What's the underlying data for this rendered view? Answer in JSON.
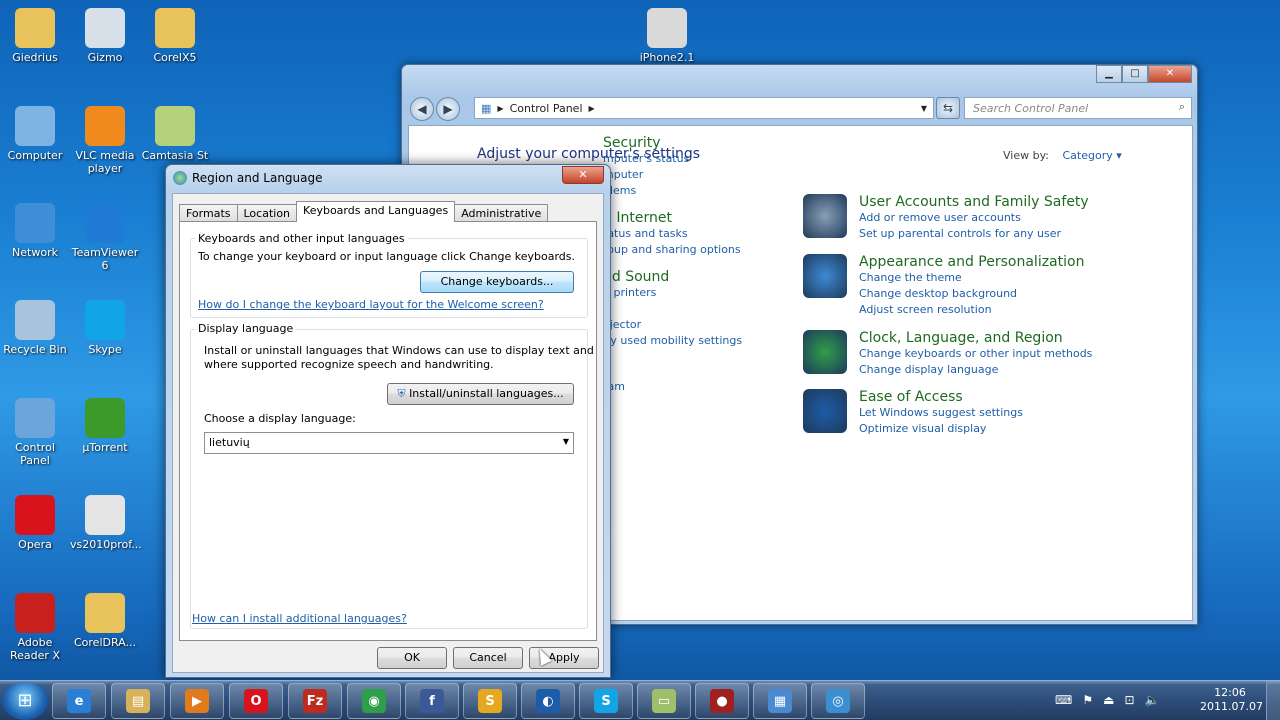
{
  "desktop": {
    "icons": [
      {
        "label": "Giedrius",
        "icon": "user-folder-icon",
        "color": "#e8c25a"
      },
      {
        "label": "Gizmo",
        "icon": "gizmo-icon",
        "color": "#d8e0ea"
      },
      {
        "label": "CorelX5",
        "icon": "folder-icon",
        "color": "#e8c25a"
      },
      {
        "label": "Computer",
        "icon": "computer-icon",
        "color": "#7eb3e6"
      },
      {
        "label": "VLC media player",
        "icon": "vlc-icon",
        "color": "#f08a1c"
      },
      {
        "label": "Camtasia St",
        "icon": "camtasia-icon",
        "color": "#b5d27a"
      },
      {
        "label": "Network",
        "icon": "network-icon",
        "color": "#3f8fd8"
      },
      {
        "label": "TeamViewer 6",
        "icon": "teamviewer-icon",
        "color": "#1f7bd6"
      },
      {
        "label": "Recycle Bin",
        "icon": "recycle-bin-icon",
        "color": "#a8c4dd"
      },
      {
        "label": "Skype",
        "icon": "skype-icon",
        "color": "#12a5e6"
      },
      {
        "label": "Control Panel",
        "icon": "control-panel-icon",
        "color": "#6aa6dc"
      },
      {
        "label": "µTorrent",
        "icon": "utorrent-icon",
        "color": "#3c9a2a"
      },
      {
        "label": "Opera",
        "icon": "opera-icon",
        "color": "#d8131c"
      },
      {
        "label": "vs2010prof...",
        "icon": "disc-icon",
        "color": "#e4e4e4"
      },
      {
        "label": "Adobe Reader X",
        "icon": "adobe-reader-icon",
        "color": "#c8201c"
      },
      {
        "label": "CorelDRA...",
        "icon": "folder-icon",
        "color": "#e8c25a"
      },
      {
        "label": "iPhone2.1",
        "icon": "iphone-icon",
        "color": "#d9d9d9"
      }
    ]
  },
  "control_panel": {
    "address": "Control Panel",
    "search_placeholder": "Search Control Panel",
    "heading": "Adjust your computer's settings",
    "view_by_label": "View by:",
    "view_by_value": "Category",
    "left_categories": [
      {
        "head": "Security",
        "links": [
          "mputer's status",
          "mputer",
          "blems"
        ]
      },
      {
        "head": "d Internet",
        "links": [
          "tatus and tasks",
          "roup and sharing options"
        ]
      },
      {
        "head": "nd Sound",
        "links": [
          "d printers",
          "",
          "ojector",
          "tly used mobility settings"
        ]
      },
      {
        "head": "",
        "links": [
          "ram"
        ]
      }
    ],
    "right_categories": [
      {
        "head": "User Accounts and Family Safety",
        "links": [
          "Add or remove user accounts",
          "Set up parental controls for any user"
        ],
        "icon": "users-icon",
        "color": "#8a9fb6"
      },
      {
        "head": "Appearance and Personalization",
        "links": [
          "Change the theme",
          "Change desktop background",
          "Adjust screen resolution"
        ],
        "icon": "appearance-icon",
        "color": "#3d8ad6"
      },
      {
        "head": "Clock, Language, and Region",
        "links": [
          "Change keyboards or other input methods",
          "Change display language"
        ],
        "icon": "clock-globe-icon",
        "color": "#2f9e4a"
      },
      {
        "head": "Ease of Access",
        "links": [
          "Let Windows suggest settings",
          "Optimize visual display"
        ],
        "icon": "ease-of-access-icon",
        "color": "#1d5ca8"
      }
    ]
  },
  "dialog": {
    "title": "Region and Language",
    "tabs": [
      "Formats",
      "Location",
      "Keyboards and Languages",
      "Administrative"
    ],
    "keyboards_group": {
      "label": "Keyboards and other input languages",
      "text": "To change your keyboard or input language click Change keyboards.",
      "button": "Change keyboards...",
      "link": "How do I change the keyboard layout for the Welcome screen?"
    },
    "display_group": {
      "label": "Display language",
      "text1": "Install or uninstall languages that Windows can use to display text and",
      "text2": "where supported recognize speech and handwriting.",
      "button": "Install/uninstall languages...",
      "choose_label": "Choose a display language:",
      "selected": "lietuvių"
    },
    "help_link": "How can I install additional languages?",
    "ok": "OK",
    "cancel": "Cancel",
    "apply": "Apply"
  },
  "taskbar": {
    "items": [
      {
        "icon": "internet-explorer-icon",
        "glyph": "e",
        "color": "#2a7fd4"
      },
      {
        "icon": "explorer-folder-icon",
        "glyph": "▤",
        "color": "#d8b25a"
      },
      {
        "icon": "media-player-icon",
        "glyph": "▶",
        "color": "#e07a1c"
      },
      {
        "icon": "opera-icon",
        "glyph": "O",
        "color": "#d8131c"
      },
      {
        "icon": "filezilla-icon",
        "glyph": "Fz",
        "color": "#bf2a1e"
      },
      {
        "icon": "chrome-icon",
        "glyph": "◉",
        "color": "#2f9e4a"
      },
      {
        "icon": "facebook-icon",
        "glyph": "f",
        "color": "#3b5998"
      },
      {
        "icon": "s-app-icon",
        "glyph": "S",
        "color": "#e6a820"
      },
      {
        "icon": "globe-app-icon",
        "glyph": "◐",
        "color": "#1d5ca8"
      },
      {
        "icon": "skype-icon",
        "glyph": "S",
        "color": "#12a5e6"
      },
      {
        "icon": "camtasia-icon",
        "glyph": "▭",
        "color": "#9fbf6a"
      },
      {
        "icon": "camera-icon",
        "glyph": "●",
        "color": "#a02020"
      },
      {
        "icon": "control-panel-icon",
        "glyph": "▦",
        "color": "#4a8ad0"
      },
      {
        "icon": "region-language-icon",
        "glyph": "◎",
        "color": "#3b8ed0"
      }
    ],
    "time": "12:06",
    "date": "2011.07.07"
  }
}
